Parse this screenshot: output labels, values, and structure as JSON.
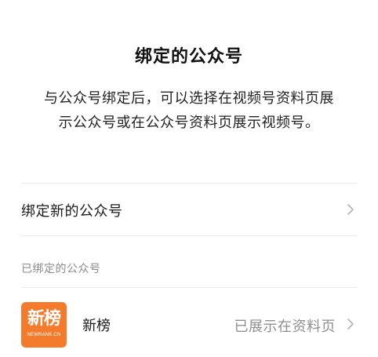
{
  "header": {
    "title": "绑定的公众号",
    "description_line1": "与公众号绑定后，可以选择在视频号资料页展",
    "description_line2": "示公众号或在公众号资料页展示视频号。"
  },
  "bind_new": {
    "label": "绑定新的公众号",
    "icon": "chevron-right-icon"
  },
  "bound_section": {
    "header": "已绑定的公众号",
    "accounts": [
      {
        "logo_text": "新榜",
        "logo_subtext": "NEWRANK.CN",
        "logo_color": "#f47a2c",
        "name": "新榜",
        "status": "已展示在资料页",
        "icon": "chevron-right-icon"
      }
    ]
  }
}
